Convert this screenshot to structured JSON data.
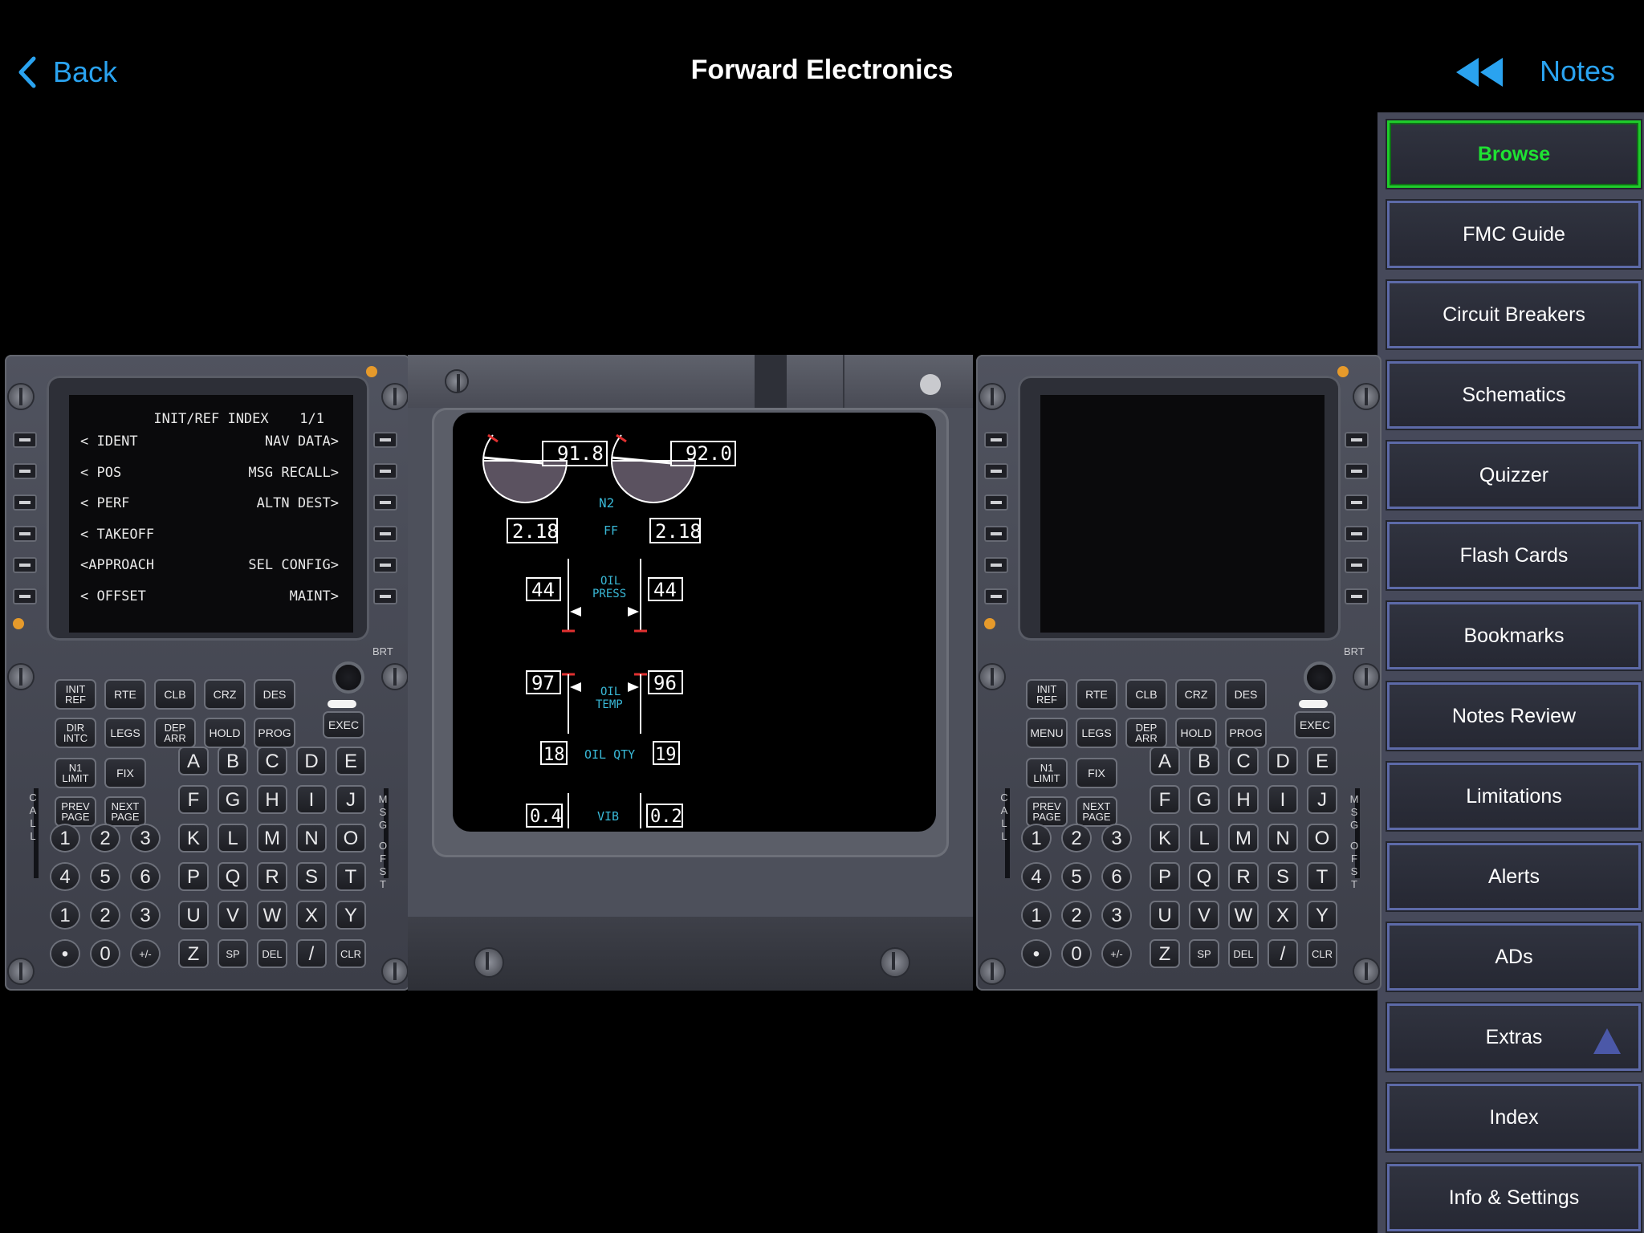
{
  "nav": {
    "back_label": "Back",
    "title": "Forward Electronics",
    "notes_label": "Notes"
  },
  "sidebar": [
    {
      "label": "Browse",
      "active": true
    },
    {
      "label": "FMC Guide"
    },
    {
      "label": "Circuit Breakers"
    },
    {
      "label": "Schematics"
    },
    {
      "label": "Quizzer"
    },
    {
      "label": "Flash Cards"
    },
    {
      "label": "Bookmarks"
    },
    {
      "label": "Notes Review"
    },
    {
      "label": "Limitations"
    },
    {
      "label": "Alerts"
    },
    {
      "label": "ADs"
    },
    {
      "label": "Extras"
    },
    {
      "label": "Index"
    },
    {
      "label": "Info & Settings"
    }
  ],
  "cdu_left": {
    "title": "INIT/REF INDEX",
    "page": "1/1",
    "rows": [
      {
        "left": "< IDENT",
        "right": "NAV DATA>"
      },
      {
        "left": "< POS",
        "right": "MSG RECALL>"
      },
      {
        "left": "< PERF",
        "right": "ALTN DEST>"
      },
      {
        "left": "< TAKEOFF",
        "right": ""
      },
      {
        "left": "<APPROACH",
        "right": "SEL CONFIG>"
      },
      {
        "left": "< OFFSET",
        "right": "MAINT>"
      }
    ],
    "func_row1": [
      "INIT REF",
      "RTE",
      "CLB",
      "CRZ",
      "DES"
    ],
    "func_row2": [
      "DIR INTC",
      "LEGS",
      "DEP ARR",
      "HOLD",
      "PROG"
    ],
    "func_row3": [
      "N1 LIMIT",
      "FIX"
    ],
    "func_row4": [
      "PREV PAGE",
      "NEXT PAGE"
    ]
  },
  "cdu_right": {
    "func_row1": [
      "INIT REF",
      "RTE",
      "CLB",
      "CRZ",
      "DES"
    ],
    "func_row2": [
      "MENU",
      "LEGS",
      "DEP ARR",
      "HOLD",
      "PROG"
    ],
    "func_row3": [
      "N1 LIMIT",
      "FIX"
    ],
    "func_row4": [
      "PREV PAGE",
      "NEXT PAGE"
    ]
  },
  "cdu_common": {
    "exec": "EXEC",
    "brt": "BRT",
    "call": "CALL",
    "msg": "MSG",
    "ofst": "OFST",
    "alpha_rows": [
      [
        "A",
        "B",
        "C",
        "D",
        "E"
      ],
      [
        "F",
        "G",
        "H",
        "I",
        "J"
      ],
      [
        "K",
        "L",
        "M",
        "N",
        "O"
      ],
      [
        "P",
        "Q",
        "R",
        "S",
        "T"
      ],
      [
        "U",
        "V",
        "W",
        "X",
        "Y"
      ],
      [
        "Z",
        "SP",
        "DEL",
        "/",
        "CLR"
      ]
    ],
    "num_rows": [
      [
        "1",
        "2",
        "3"
      ],
      [
        "4",
        "5",
        "6"
      ],
      [
        "1",
        "2",
        "3"
      ],
      [
        "•",
        "0",
        "+/-"
      ]
    ]
  },
  "eicas": {
    "n2_left": "91.8",
    "n2_right": "92.0",
    "n2_label": "N2",
    "ff_left": "2.18",
    "ff_right": "2.18",
    "ff_label": "FF",
    "oil_press_left": "44",
    "oil_press_right": "44",
    "oil_press_label_1": "OIL",
    "oil_press_label_2": "PRESS",
    "oil_temp_left": "97",
    "oil_temp_right": "96",
    "oil_temp_label_1": "OIL",
    "oil_temp_label_2": "TEMP",
    "oil_qty_left": "18",
    "oil_qty_right": "19",
    "oil_qty_label": "OIL QTY",
    "vib_left": "0.4",
    "vib_right": "0.2",
    "vib_label": "VIB",
    "colors": {
      "cyan": "#39b8d6",
      "redline": "#e03030",
      "box": "#ffffff"
    }
  },
  "icons": {
    "back": "chevron-left-icon",
    "rewind": "rewind-icon",
    "extras_indicator": "triangle-up-icon"
  }
}
